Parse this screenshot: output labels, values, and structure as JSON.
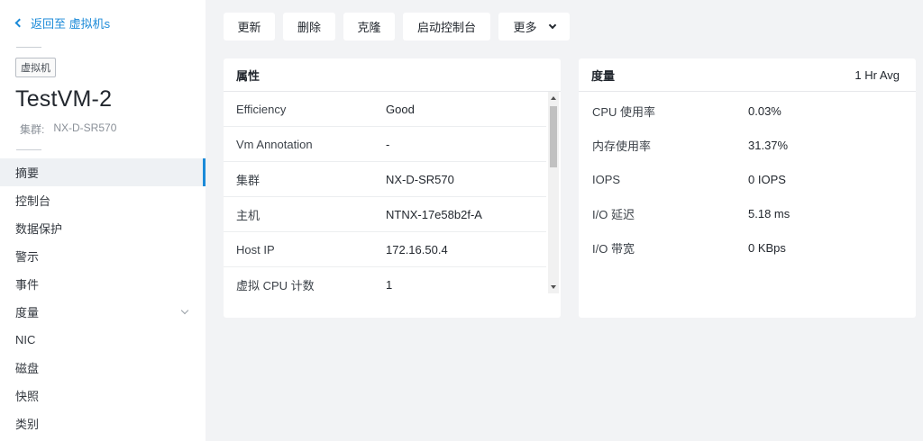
{
  "sidebar": {
    "back_label": "返回至 虚拟机s",
    "entity_tag": "虚拟机",
    "vm_name": "TestVM-2",
    "cluster_label": "集群:",
    "cluster_value": "NX-D-SR570",
    "nav": [
      {
        "label": "摘要"
      },
      {
        "label": "控制台"
      },
      {
        "label": "数据保护"
      },
      {
        "label": "警示"
      },
      {
        "label": "事件"
      },
      {
        "label": "度量"
      },
      {
        "label": "NIC"
      },
      {
        "label": "磁盘"
      },
      {
        "label": "快照"
      },
      {
        "label": "类别"
      }
    ]
  },
  "toolbar": {
    "update": "更新",
    "delete": "删除",
    "clone": "克隆",
    "launch_console": "启动控制台",
    "more": "更多"
  },
  "properties": {
    "title": "属性",
    "rows": [
      {
        "key": "Efficiency",
        "value": "Good"
      },
      {
        "key": "Vm Annotation",
        "value": "-"
      },
      {
        "key": "集群",
        "value": "NX-D-SR570"
      },
      {
        "key": "主机",
        "value": "NTNX-17e58b2f-A"
      },
      {
        "key": "Host IP",
        "value": "172.16.50.4"
      },
      {
        "key": "虚拟 CPU 计数",
        "value": "1"
      }
    ]
  },
  "metrics": {
    "title": "度量",
    "period": "1 Hr Avg",
    "rows": [
      {
        "key": "CPU 使用率",
        "value": "0.03%"
      },
      {
        "key": "内存使用率",
        "value": "31.37%"
      },
      {
        "key": "IOPS",
        "value": "0 IOPS"
      },
      {
        "key": "I/O 延迟",
        "value": "5.18 ms"
      },
      {
        "key": "I/O 带宽",
        "value": "0 KBps"
      }
    ]
  },
  "colors": {
    "accent": "#1b8ad8",
    "background": "#f2f3f5"
  }
}
